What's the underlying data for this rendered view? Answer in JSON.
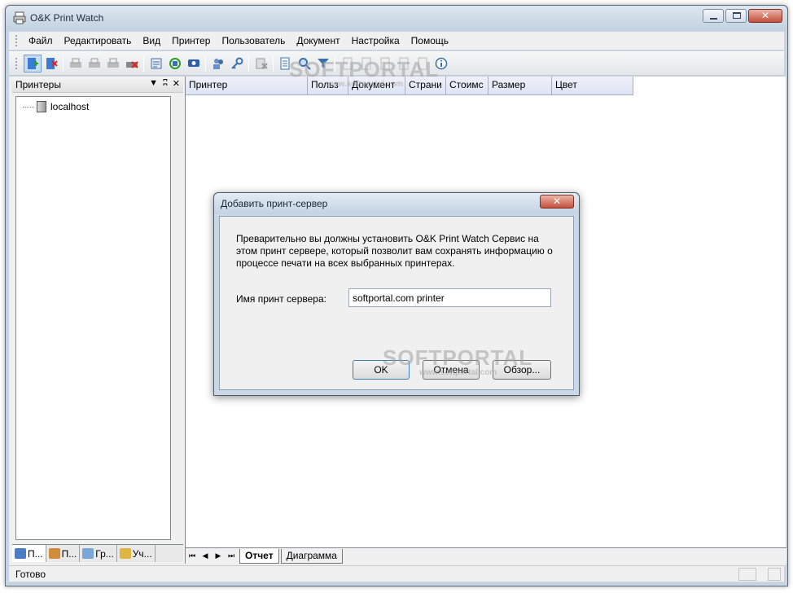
{
  "window": {
    "title": "O&K Print Watch"
  },
  "menu": [
    "Файл",
    "Редактировать",
    "Вид",
    "Принтер",
    "Пользователь",
    "Документ",
    "Настройка",
    "Помощь"
  ],
  "toolbar": {
    "groups": [
      [
        "add-server",
        "remove-server"
      ],
      [
        "add-printer",
        "edit-printer",
        "printer-props",
        "delete-printer"
      ],
      [
        "export-report",
        "refresh",
        "monitor"
      ],
      [
        "users",
        "key"
      ],
      [
        "delete-entry"
      ],
      [
        "report-view",
        "search",
        "filter"
      ],
      [
        "page-1",
        "page-2",
        "page-3",
        "page-4",
        "page-5",
        "info"
      ]
    ]
  },
  "left_panel": {
    "title": "Принтеры",
    "tree": [
      {
        "label": "localhost"
      }
    ],
    "tabs": [
      {
        "label": "П...",
        "active": true
      },
      {
        "label": "П...",
        "active": false
      },
      {
        "label": "Гр...",
        "active": false
      },
      {
        "label": "Уч...",
        "active": false
      }
    ]
  },
  "grid": {
    "columns": [
      "Принтер",
      "Польз",
      "Документ",
      "Страни",
      "Стоимс",
      "Размер",
      "Цвет"
    ]
  },
  "bottom_tabs": [
    {
      "label": "Отчет",
      "active": true
    },
    {
      "label": "Диаграмма",
      "active": false
    }
  ],
  "status": {
    "text": "Готово"
  },
  "dialog": {
    "title": "Добавить принт-сервер",
    "message": "Преварительно вы должны установить O&K Print Watch Сервис на этом принт сервере, который позволит вам сохранять информацию о процессе печати на всех выбранных принтерах.",
    "label": "Имя принт сервера:",
    "input_value": "softportal.com printer",
    "ok": "OK",
    "cancel": "Отмена",
    "browse": "Обзор..."
  },
  "watermark": {
    "text": "SOFTPORTAL",
    "url": "www.softportal.com"
  }
}
